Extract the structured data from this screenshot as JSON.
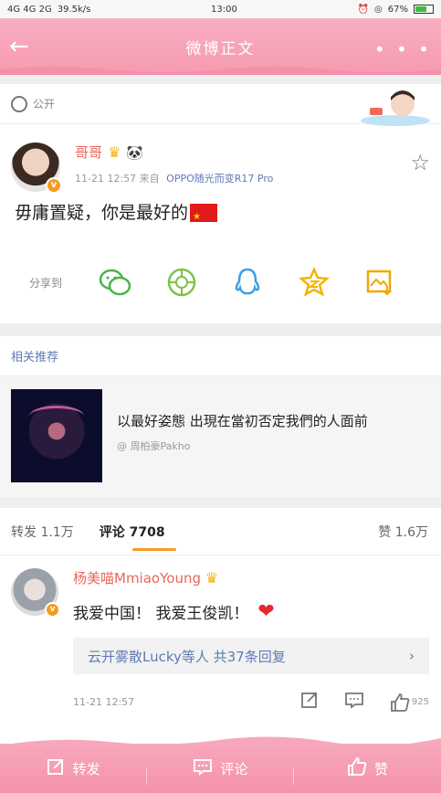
{
  "status": {
    "network": "4G 4G 2G",
    "speed": "39.5k/s",
    "time": "13:00",
    "battery": "67%",
    "battery_level": 0.67
  },
  "titlebar": {
    "title": "微博正文",
    "back_icon": "arrow-left-icon",
    "more_icon": "more-dots-icon",
    "more_glyph": "• • •"
  },
  "visibility": {
    "label": "公开",
    "icon": "globe-icon"
  },
  "post": {
    "username": "哥哥",
    "verified": "v",
    "timestamp": "11-21 12:57",
    "source_prefix": "来自",
    "source": "OPPO随光而变R17 Pro",
    "text": "毋庸置疑，你是最好的",
    "favorite_icon": "star-outline-icon"
  },
  "share": {
    "label": "分享到",
    "targets": [
      "wechat-icon",
      "moments-icon",
      "qq-icon",
      "qzone-icon",
      "save-image-icon"
    ]
  },
  "related": {
    "heading": "相关推荐",
    "title": "以最好姿態 出現在當初否定我們的人面前",
    "author": "@ 周柏豪Pakho"
  },
  "tabs": {
    "repost": "转发 1.1万",
    "comments": "评论 7708",
    "likes": "赞 1.6万"
  },
  "comment": {
    "username": "杨美喵MmiaoYoung",
    "verified": "v",
    "text": "我爱中国！ 我爱王俊凯！",
    "replies": "云开雾散Lucky等人  共37条回复",
    "replies_arrow": "›",
    "timestamp": "11-21 12:57",
    "like_count": "925"
  },
  "bottom_bar": {
    "repost": "转发",
    "comment": "评论",
    "like": "赞"
  },
  "colors": {
    "brand_pink": "#f69ab1",
    "username_red": "#e8675a",
    "link_blue": "#5f7bb5",
    "accent_orange": "#f59b23"
  }
}
